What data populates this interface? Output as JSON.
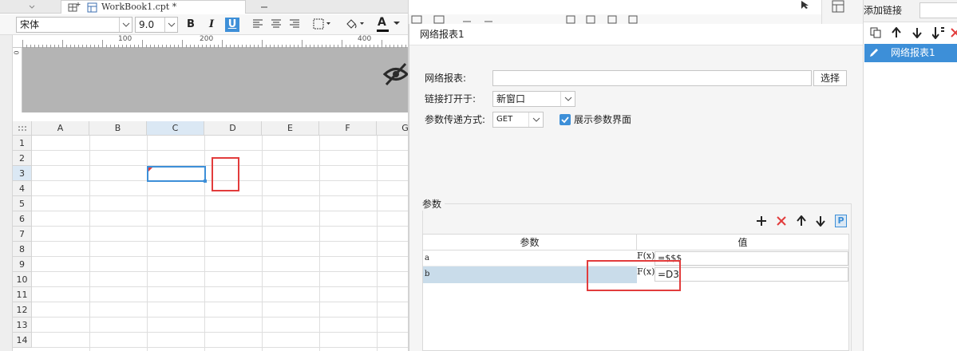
{
  "editor": {
    "tab_label": "WorkBook1.cpt *",
    "font_name": "宋体",
    "font_size": "9.0",
    "bold": "B",
    "italic": "I",
    "underline": "U",
    "font_color_icon": "A",
    "ruler_marks": [
      "0",
      "100",
      "200",
      "400"
    ],
    "ruler_v_mark": "0",
    "columns": [
      "A",
      "B",
      "C",
      "D",
      "E",
      "F",
      "G"
    ],
    "rows": [
      "1",
      "2",
      "3",
      "4",
      "5",
      "6",
      "7",
      "8",
      "9",
      "10",
      "11",
      "12",
      "13",
      "14"
    ],
    "selected_cell": "C3",
    "accent": "#3d8fd8"
  },
  "dialog": {
    "title": "网络报表1",
    "report_label": "网络报表:",
    "report_value": "",
    "select_button": "选择",
    "open_in_label": "链接打开于:",
    "open_in_value": "新窗口",
    "method_label": "参数传递方式:",
    "method_value": "GET",
    "show_params_label": "展示参数界面",
    "show_params_checked": true,
    "params_legend": "参数",
    "params_header_name": "参数",
    "params_header_value": "值",
    "params": [
      {
        "name": "a",
        "fx": "F(x)",
        "value": "=$$$"
      },
      {
        "name": "b",
        "fx": "F(x)",
        "value": "=D3"
      }
    ]
  },
  "right_panel": {
    "title": "添加链接",
    "items": [
      "网络报表1"
    ]
  }
}
